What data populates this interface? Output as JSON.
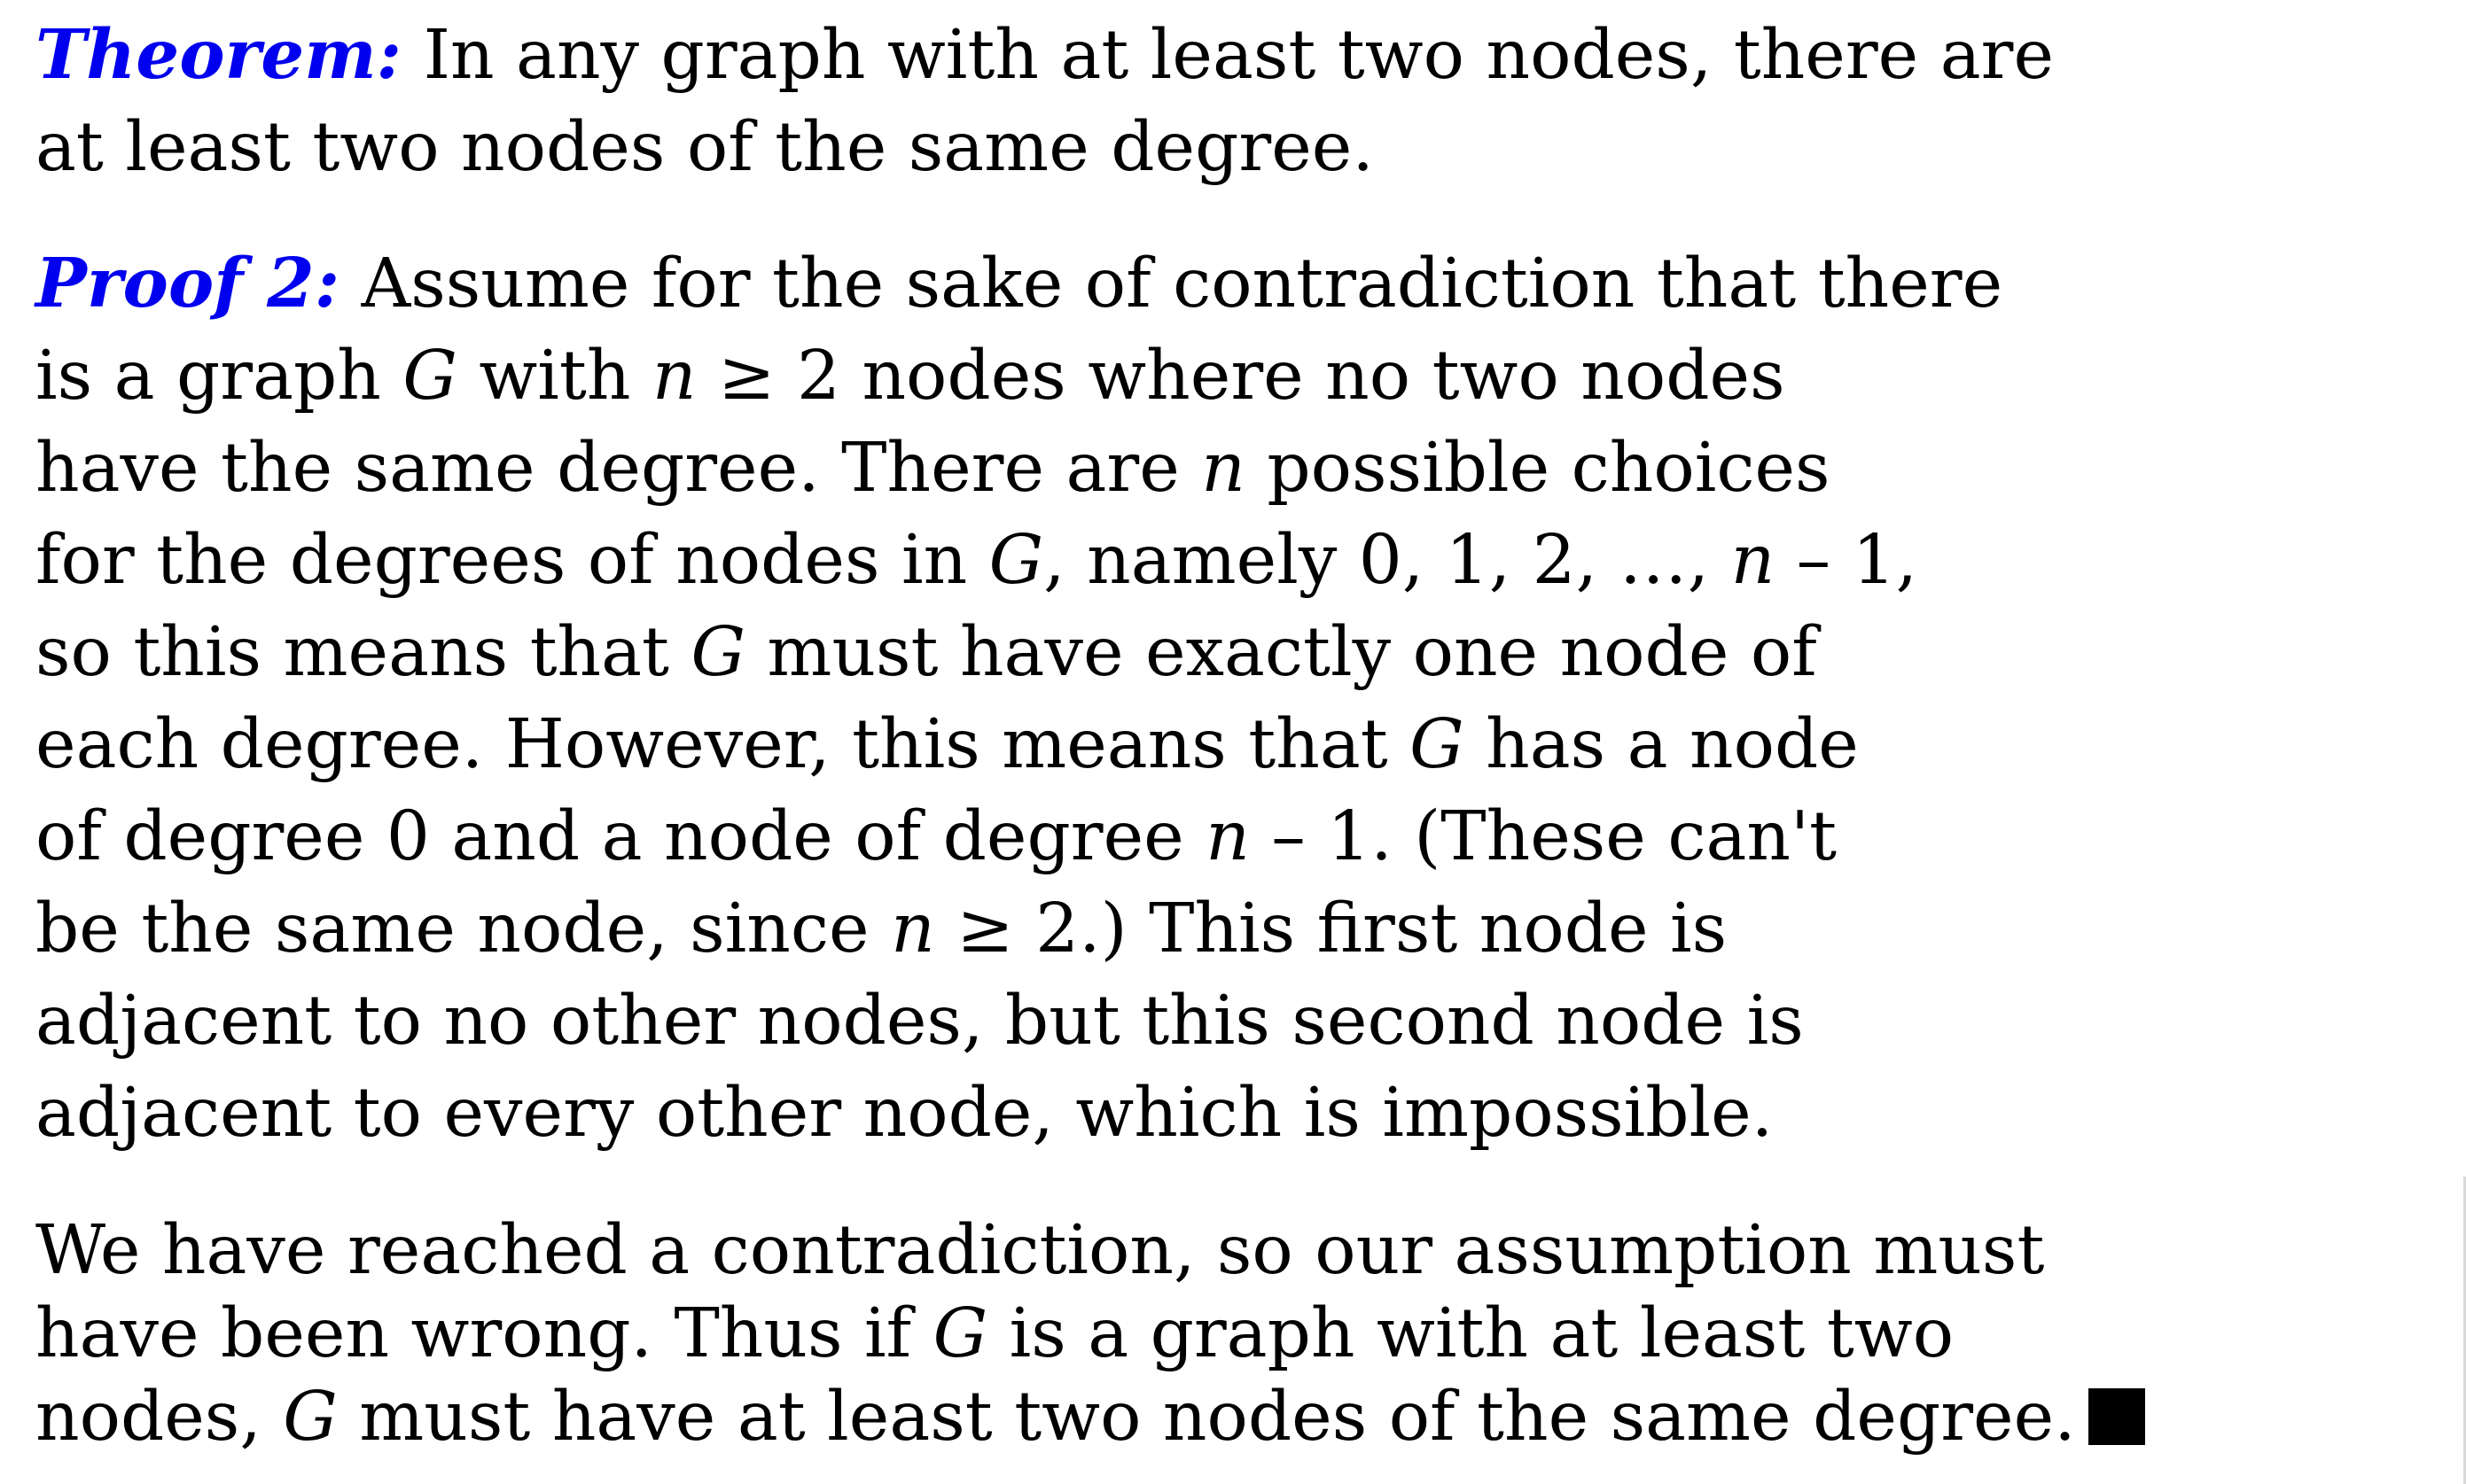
{
  "theorem": {
    "label": "Theorem:",
    "lines": [
      "In any graph with at least two nodes, there are",
      "at least two nodes of the same degree."
    ]
  },
  "proof": {
    "label": "Proof 2:",
    "l1": "Assume for the sake of contradiction that there",
    "l2": {
      "a": "is a graph ",
      "G": "G",
      "b": " with ",
      "n": "n",
      "c": " ≥ 2 nodes where no two nodes"
    },
    "l3": {
      "a": "have the same degree. There are ",
      "n": "n",
      "b": " possible choices"
    },
    "l4": {
      "a": "for the degrees of nodes in ",
      "G": "G",
      "b": ", namely 0, 1, 2, …, ",
      "n": "n",
      "c": " – 1,"
    },
    "l5": {
      "a": "so this means that ",
      "G": "G",
      "b": " must have exactly one node of"
    },
    "l6": {
      "a": "each degree. However, this means that ",
      "G": "G",
      "b": " has a node"
    },
    "l7": {
      "a": "of degree 0 and a node of degree ",
      "n": "n",
      "b": " – 1. (These can't"
    },
    "l8": {
      "a": "be the same node, since ",
      "n": "n",
      "b": " ≥ 2.) This first node is"
    },
    "l9": "adjacent to no other nodes, but this second node is",
    "l10": "adjacent to every other node, which is impossible."
  },
  "conclusion": {
    "l1": "We have reached a contradiction, so our assumption must",
    "l2": {
      "a": "have been wrong. Thus if ",
      "G": "G",
      "b": " is a graph with at least two"
    },
    "l3": {
      "a": "nodes, ",
      "G": "G",
      "b": " must have at least two nodes of the same degree."
    }
  }
}
